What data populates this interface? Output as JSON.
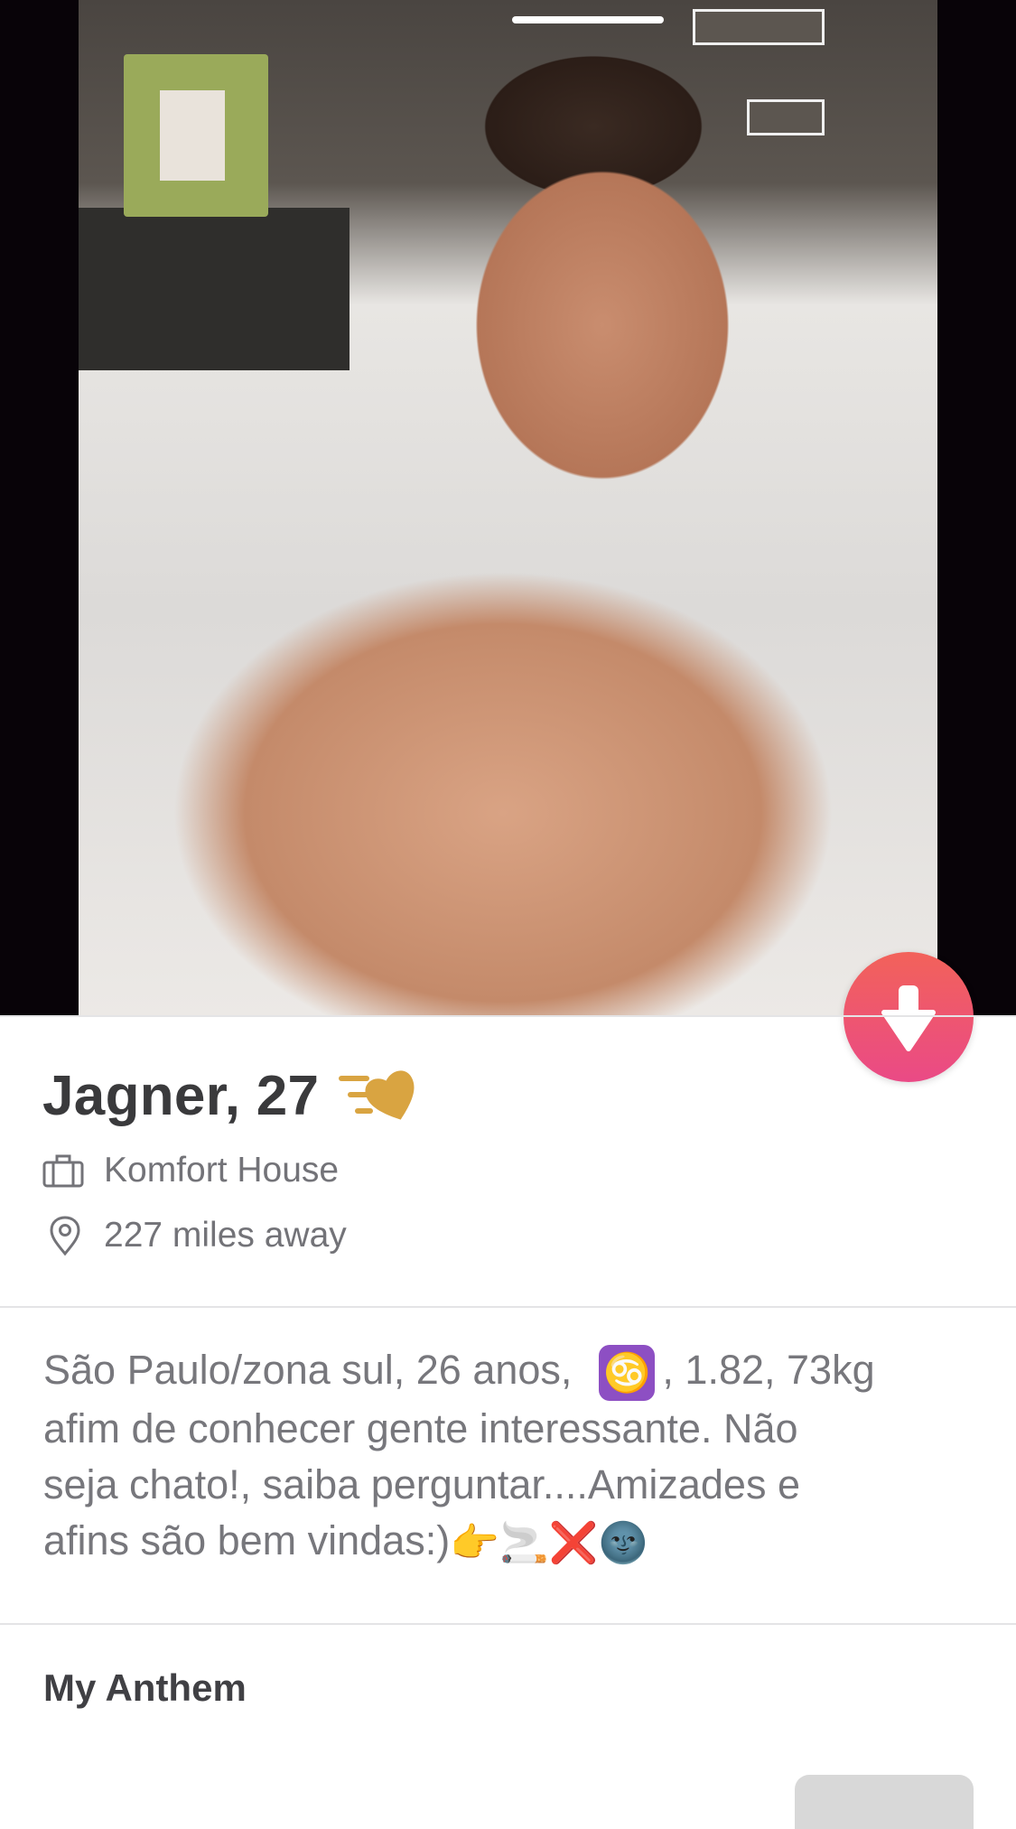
{
  "profile": {
    "name_age": "Jagner, 27",
    "job": "Komfort House",
    "distance": "227 miles away",
    "bio_line1": "São Paulo/zona sul,  26 anos,",
    "bio_line1_after": ", 1.82, 73kg",
    "bio_line2": "afim de conhecer gente interessante. Não",
    "bio_line3": "seja chato!, saiba perguntar....Amizades e",
    "bio_line4": "afins são bem vindas:)",
    "zodiac_symbol": "♋",
    "bio_emojis": [
      "👉",
      "🚬",
      "❌",
      "🌚"
    ]
  },
  "anthem": {
    "section_title": "My Anthem"
  },
  "colors": {
    "accent_gradient_start": "#f2625a",
    "accent_gradient_end": "#ea4a86",
    "superlike_gold": "#d9a441"
  },
  "icons": {
    "info_button": "arrow-down-icon",
    "job": "briefcase-icon",
    "location": "location-pin-icon",
    "badge": "super-like-heart-icon"
  }
}
